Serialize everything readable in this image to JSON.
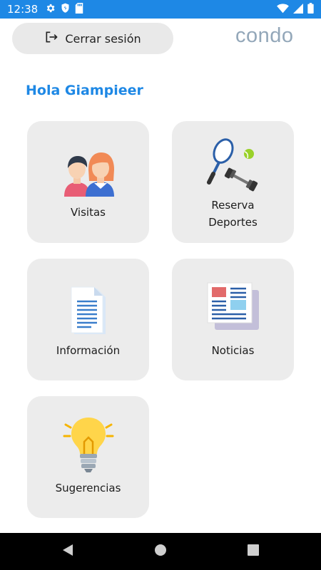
{
  "status_bar": {
    "time": "12:38",
    "icons_left": [
      "gear-icon",
      "shield-icon",
      "sd-card-icon"
    ],
    "icons_right": [
      "wifi-icon",
      "signal-icon",
      "battery-icon"
    ],
    "color": "#1e88e5"
  },
  "header": {
    "logout_label": "Cerrar sesión",
    "brand": "condo"
  },
  "greeting": "Hola Giampieer",
  "menu": {
    "items": [
      {
        "label": "Visitas",
        "icon": "visitors-icon"
      },
      {
        "label_line1": "Reserva",
        "label_line2": "Deportes",
        "icon": "sports-icon"
      },
      {
        "label": "Información",
        "icon": "document-icon"
      },
      {
        "label": "Noticias",
        "icon": "newspaper-icon"
      },
      {
        "label": "Sugerencias",
        "icon": "lightbulb-icon"
      }
    ]
  },
  "nav_bar": [
    "back-icon",
    "home-icon",
    "recents-icon"
  ],
  "colors": {
    "accent": "#1e88e5",
    "card_bg": "#ececec",
    "logo": "#93a7b9"
  }
}
